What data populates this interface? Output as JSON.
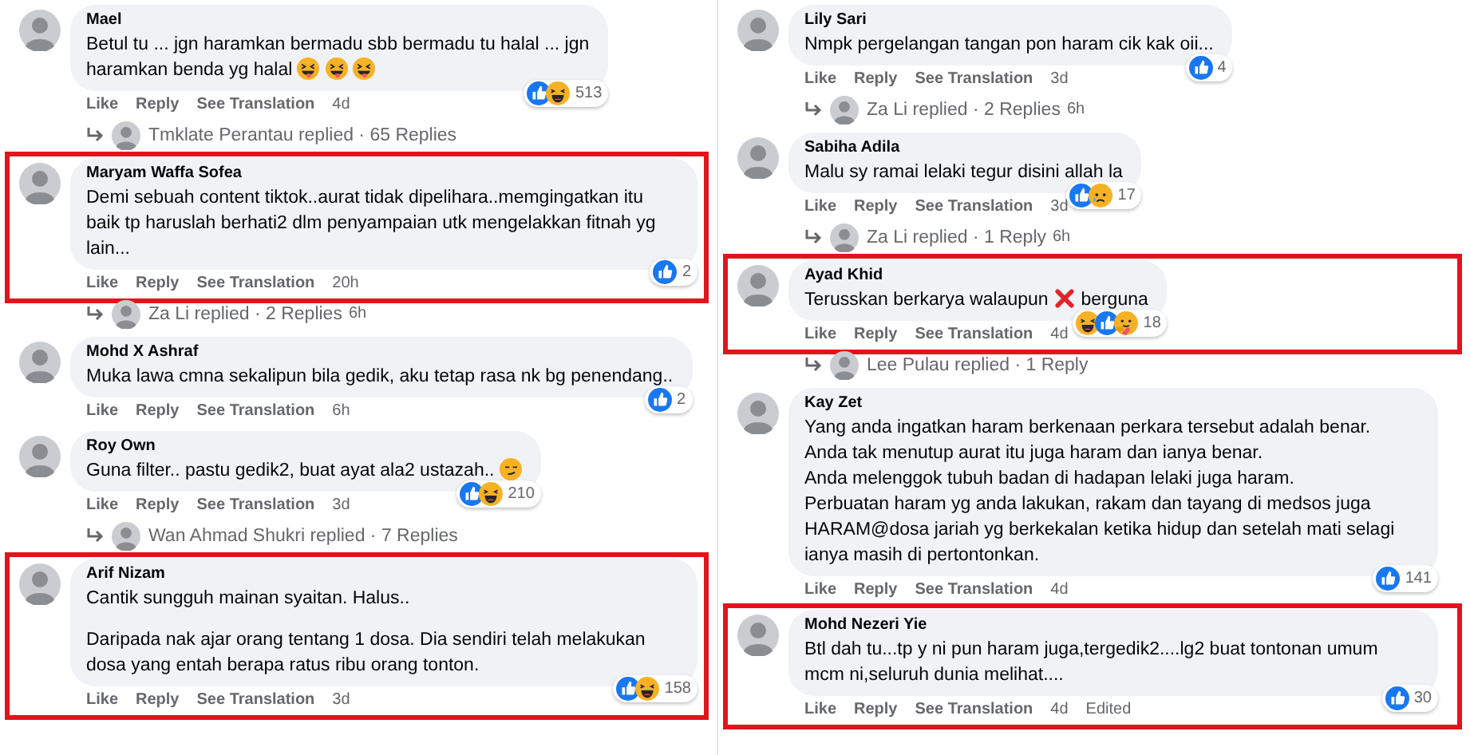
{
  "columns": [
    {
      "items": [
        {
          "kind": "comment",
          "name": "Mael",
          "highlighted": false,
          "spaced": false,
          "paragraphs": [
            [
              {
                "kind": "text",
                "text": "Betul tu ... jgn haramkan bermadu sbb bermadu tu halal ... jgn"
              }
            ],
            [
              {
                "kind": "text",
                "text": "haramkan benda yg halal"
              },
              {
                "kind": "tongue"
              },
              {
                "kind": "tongue"
              },
              {
                "kind": "tongue"
              }
            ]
          ],
          "actions": [
            "Like",
            "Reply",
            "See Translation"
          ],
          "time": "4d",
          "reactions": {
            "icons": [
              {
                "kind": "like"
              },
              {
                "kind": "haha"
              }
            ],
            "count": "513"
          }
        },
        {
          "kind": "replies",
          "text": "Tmklate Perantau replied · 65 Replies"
        },
        {
          "kind": "comment",
          "name": "Maryam Waffa Sofea",
          "highlighted": true,
          "paragraphs": [
            [
              {
                "kind": "text",
                "text": "Demi sebuah content tiktok..aurat tidak dipelihara..memgingatkan itu baik tp haruslah berhati2 dlm penyampaian utk mengelakkan fitnah yg lain..."
              }
            ]
          ],
          "actions": [
            "Like",
            "Reply",
            "See Translation"
          ],
          "time": "20h",
          "reactions": {
            "icons": [
              {
                "kind": "like"
              }
            ],
            "count": "2"
          }
        },
        {
          "kind": "replies",
          "text": "Za Li replied · 2 Replies",
          "time": "6h"
        },
        {
          "kind": "comment",
          "name": "Mohd X Ashraf",
          "highlighted": false,
          "paragraphs": [
            [
              {
                "kind": "text",
                "text": "Muka lawa cmna sekalipun bila gedik, aku tetap rasa nk bg penendang.."
              }
            ]
          ],
          "actions": [
            "Like",
            "Reply",
            "See Translation"
          ],
          "time": "6h",
          "reactions": {
            "icons": [
              {
                "kind": "like"
              }
            ],
            "count": "2"
          }
        },
        {
          "kind": "comment",
          "name": "Roy Own",
          "highlighted": false,
          "paragraphs": [
            [
              {
                "kind": "text",
                "text": "Guna filter.. pastu gedik2, buat ayat ala2 ustazah.."
              },
              {
                "kind": "smirk"
              }
            ]
          ],
          "actions": [
            "Like",
            "Reply",
            "See Translation"
          ],
          "time": "3d",
          "reactions": {
            "icons": [
              {
                "kind": "like"
              },
              {
                "kind": "haha"
              }
            ],
            "count": "210"
          }
        },
        {
          "kind": "replies",
          "text": "Wan Ahmad Shukri replied · 7 Replies"
        },
        {
          "kind": "comment",
          "name": "Arif Nizam",
          "highlighted": true,
          "spaced": true,
          "paragraphs": [
            [
              {
                "kind": "text",
                "text": "Cantik sungguh mainan syaitan. Halus.."
              }
            ],
            [
              {
                "kind": "text",
                "text": "Daripada nak ajar orang tentang 1 dosa. Dia sendiri telah melakukan dosa yang entah berapa ratus ribu orang tonton."
              }
            ]
          ],
          "actions": [
            "Like",
            "Reply",
            "See Translation"
          ],
          "time": "3d",
          "reactions": {
            "icons": [
              {
                "kind": "like"
              },
              {
                "kind": "haha"
              }
            ],
            "count": "158"
          }
        }
      ]
    },
    {
      "items": [
        {
          "kind": "comment",
          "name": "Lily Sari",
          "highlighted": false,
          "paragraphs": [
            [
              {
                "kind": "text",
                "text": "Nmpk pergelangan tangan pon haram cik kak oii..."
              }
            ]
          ],
          "actions": [
            "Like",
            "Reply",
            "See Translation"
          ],
          "time": "3d",
          "reactions": {
            "icons": [
              {
                "kind": "like"
              }
            ],
            "count": "4"
          }
        },
        {
          "kind": "replies",
          "text": "Za Li replied · 2 Replies",
          "time": "6h"
        },
        {
          "kind": "comment",
          "name": "Sabiha Adila",
          "highlighted": false,
          "paragraphs": [
            [
              {
                "kind": "text",
                "text": "Malu sy ramai lelaki tegur disini allah la"
              }
            ]
          ],
          "actions": [
            "Like",
            "Reply",
            "See Translation"
          ],
          "time": "3d",
          "reactions": {
            "icons": [
              {
                "kind": "like"
              },
              {
                "kind": "sad"
              }
            ],
            "count": "17"
          }
        },
        {
          "kind": "replies",
          "text": "Za Li replied · 1 Reply",
          "time": "6h"
        },
        {
          "kind": "comment",
          "name": "Ayad Khid",
          "highlighted": true,
          "paragraphs": [
            [
              {
                "kind": "text",
                "text": "Terusskan berkarya walaupun"
              },
              {
                "kind": "cross"
              },
              {
                "kind": "text",
                "text": "berguna"
              }
            ]
          ],
          "actions": [
            "Like",
            "Reply",
            "See Translation"
          ],
          "time": "4d",
          "reactions": {
            "icons": [
              {
                "kind": "haha"
              },
              {
                "kind": "like"
              },
              {
                "kind": "care"
              }
            ],
            "count": "18"
          }
        },
        {
          "kind": "replies",
          "text": "Lee Pulau replied · 1 Reply"
        },
        {
          "kind": "comment",
          "name": "Kay Zet",
          "highlighted": false,
          "spaced": false,
          "paragraphs": [
            [
              {
                "kind": "text",
                "text": "Yang anda ingatkan haram berkenaan perkara tersebut adalah benar."
              }
            ],
            [
              {
                "kind": "text",
                "text": "Anda tak menutup aurat itu juga haram dan ianya benar."
              }
            ],
            [
              {
                "kind": "text",
                "text": "Anda melenggok tubuh badan di hadapan lelaki juga haram."
              }
            ],
            [
              {
                "kind": "text",
                "text": "Perbuatan haram yg anda lakukan, rakam dan tayang di medsos juga HARAM@dosa jariah yg berkekalan ketika hidup dan setelah mati selagi ianya masih di pertontonkan."
              }
            ]
          ],
          "actions": [
            "Like",
            "Reply",
            "See Translation"
          ],
          "time": "4d",
          "reactions": {
            "icons": [
              {
                "kind": "like"
              }
            ],
            "count": "141"
          }
        },
        {
          "kind": "comment",
          "name": "Mohd Nezeri Yie",
          "highlighted": true,
          "paragraphs": [
            [
              {
                "kind": "text",
                "text": "Btl dah tu...tp y ni pun haram juga,tergedik2....lg2 buat tontonan umum mcm ni,seluruh dunia melihat...."
              }
            ]
          ],
          "actions": [
            "Like",
            "Reply",
            "See Translation"
          ],
          "time": "4d",
          "edited": "Edited",
          "reactions": {
            "icons": [
              {
                "kind": "like"
              }
            ],
            "count": "30"
          }
        }
      ]
    }
  ]
}
